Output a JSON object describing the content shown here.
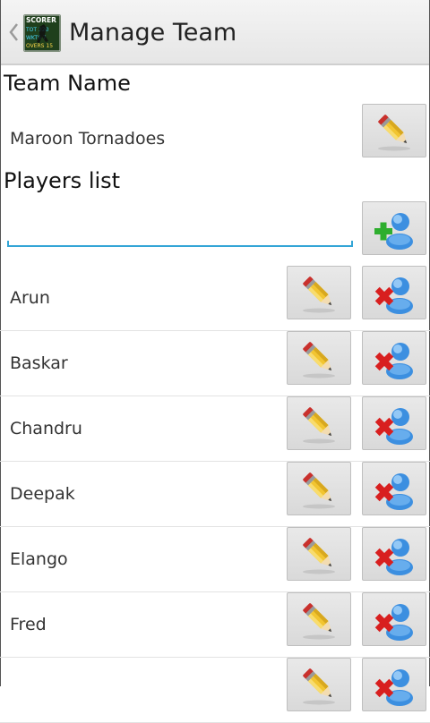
{
  "header": {
    "title": "Manage Team",
    "app_icon_lines": [
      "SCORER",
      "TOT 320",
      "WKTS 7",
      "OVERS 15"
    ]
  },
  "team": {
    "section_label": "Team Name",
    "name": "Maroon Tornadoes"
  },
  "players": {
    "section_label": "Players list",
    "new_player_input": {
      "value": "",
      "placeholder": ""
    },
    "items": [
      {
        "name": "Arun"
      },
      {
        "name": "Baskar"
      },
      {
        "name": "Chandru"
      },
      {
        "name": "Deepak"
      },
      {
        "name": "Elango"
      },
      {
        "name": "Fred"
      },
      {
        "name": ""
      }
    ]
  },
  "icons": {
    "back": "chevron-left-icon",
    "edit": "pencil-icon",
    "add": "add-user-icon",
    "delete": "remove-user-icon"
  },
  "colors": {
    "input_underline": "#33a5d6",
    "add_badge": "#2eae2e",
    "delete_badge": "#d81f1f",
    "person_icon": "#3c8fe0",
    "pencil_body": "#f2c531",
    "pencil_eraser": "#c9302c"
  }
}
